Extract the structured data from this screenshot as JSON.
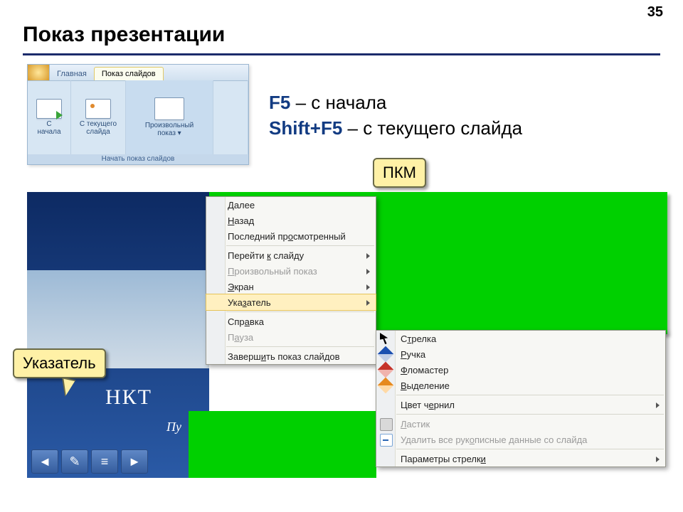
{
  "page_number": "35",
  "title": "Показ презентации",
  "keys": {
    "k1": "F5",
    "t1": " – с начала",
    "k2": "Shift+F5",
    "t2": " – с текущего слайда"
  },
  "ribbon": {
    "tab_home": "Главная",
    "tab_slideshow": "Показ слайдов",
    "btn_from_start": "С\nначала",
    "btn_from_current": "С текущего\nслайда",
    "btn_custom": "Произвольный\nпоказ ▾",
    "group_caption": "Начать показ слайдов"
  },
  "callouts": {
    "rmb": "ПКМ",
    "pointer": "Указатель"
  },
  "preview": {
    "big": "НКТ",
    "small": "Пу"
  },
  "nav_icons": [
    "◄",
    "✎",
    "≡",
    "►"
  ],
  "menu1": {
    "next": "Далее",
    "back": "Назад",
    "last": "Последний просмотренный",
    "goto": "Перейти к слайду",
    "custom": "Произвольный показ",
    "screen": "Экран",
    "pointer": "Указатель",
    "help": "Справка",
    "pause": "Пауза",
    "end": "Завершить показ слайдов"
  },
  "menu2": {
    "arrow": "Стрелка",
    "pen": "Ручка",
    "felt": "Фломастер",
    "highlight": "Выделение",
    "ink_color": "Цвет чернил",
    "eraser": "Ластик",
    "erase_all": "Удалить все рукописные данные со слайда",
    "arrow_opts": "Параметры стрелки"
  }
}
